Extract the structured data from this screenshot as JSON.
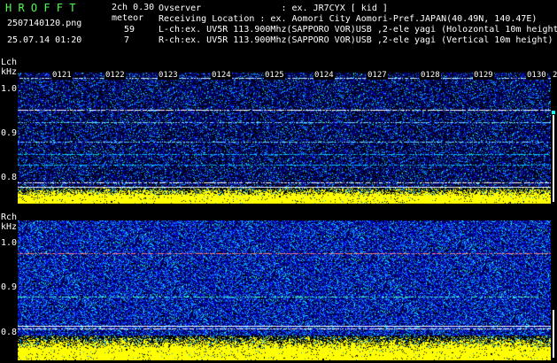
{
  "header": {
    "logo": "H R O F F T",
    "version": "2ch 0.30",
    "filename": "2507140120.png",
    "mode_label": "meteor",
    "date_time": "25.07.14 01:20",
    "count_l": "59",
    "count_r": "7",
    "observer": "Ovserver               : ex. JR7CYX [ kid ]",
    "location": "Receiving Location : ex. Aomori City Aomori-Pref.JAPAN(40.49N, 140.47E)",
    "lch_info": "L-ch:ex. UV5R 113.900Mhz(SAPPORO VOR)USB ,2-ele yagi (Holozontal 10m height)",
    "rch_info": "R-ch:ex. UV5R 113.900Mhz(SAPPORO VOR)USB ,2-ele yagi (Vertical 10m height)"
  },
  "lch": {
    "title": "Lch",
    "unit": "kHz",
    "yticks": [
      "1.0",
      "0.9",
      "0.8"
    ],
    "time_labels": [
      "0121",
      "0122",
      "0123",
      "0124",
      "0125",
      "0124",
      "0127",
      "0128",
      "0129",
      "0130",
      "2"
    ]
  },
  "rch": {
    "title": "Rch",
    "unit": "kHz",
    "yticks": [
      "1.0",
      "0.9",
      "0.8"
    ]
  },
  "colors": {
    "background": "#000000",
    "logo": "#4dff4d",
    "text": "#ffffff",
    "noise_low": "#000080",
    "noise_mid": "#1e5cff",
    "noise_high": "#00ffff",
    "level_bar": "#ffff00"
  }
}
